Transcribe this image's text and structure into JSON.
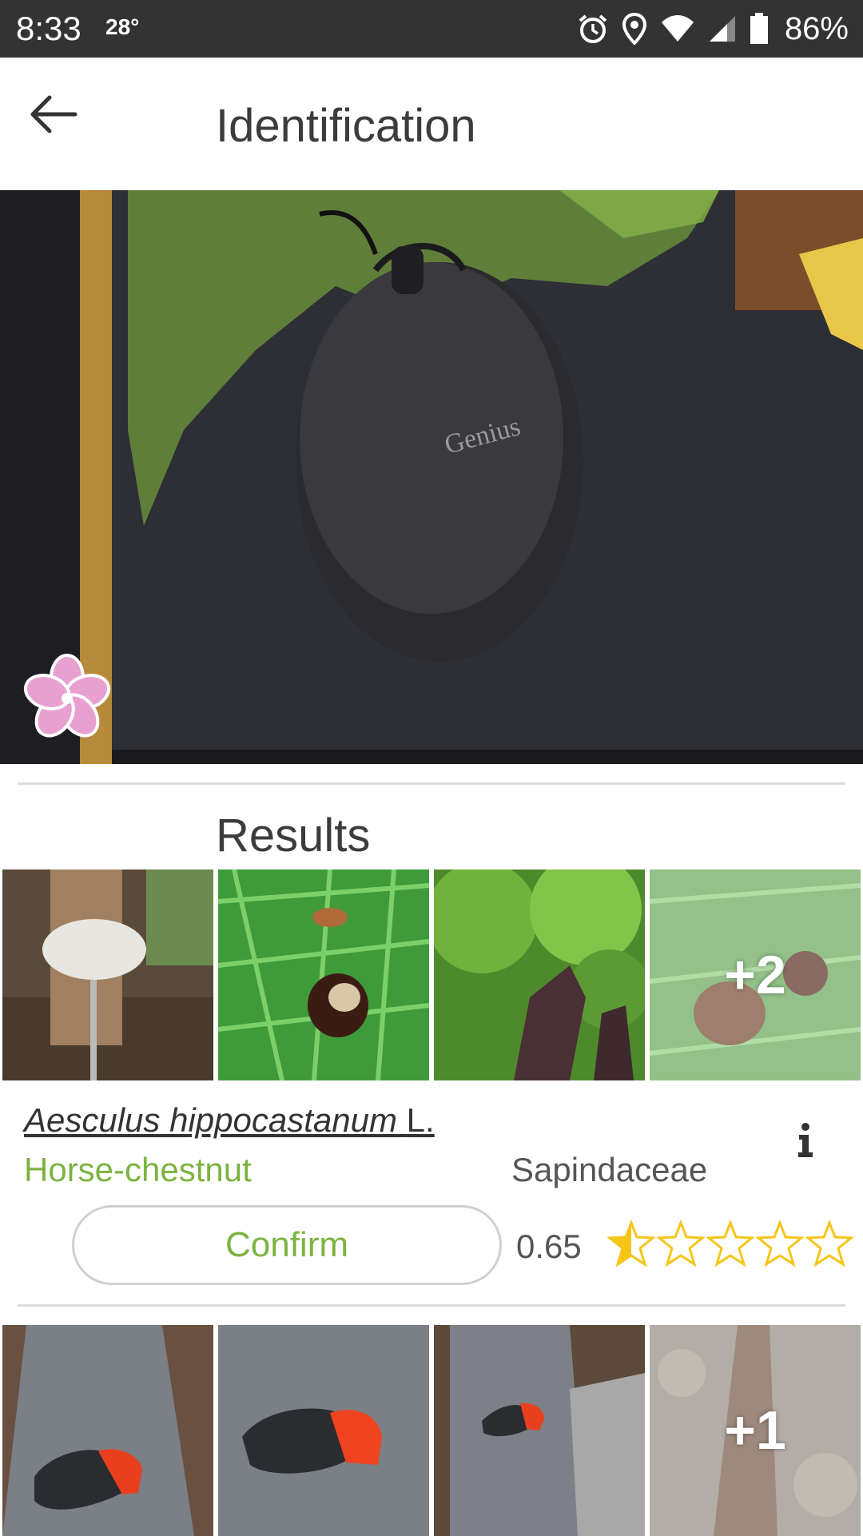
{
  "status": {
    "time": "8:33",
    "temperature": "28°",
    "battery": "86%"
  },
  "header": {
    "title": "Identification",
    "back_icon": "arrow-left-icon"
  },
  "results": {
    "title": "Results",
    "items": [
      {
        "scientific_name": "Aesculus hippocastanum",
        "author": "L.",
        "common_name": "Horse-chestnut",
        "family": "Sapindaceae",
        "confirm_label": "Confirm",
        "score": "0.65",
        "rating": 0.5,
        "rating_max": 5,
        "more_count": "+2"
      },
      {
        "more_count": "+1"
      }
    ]
  },
  "colors": {
    "accent": "#7cb342",
    "status_bar": "#333333",
    "star": "#f5c518"
  }
}
